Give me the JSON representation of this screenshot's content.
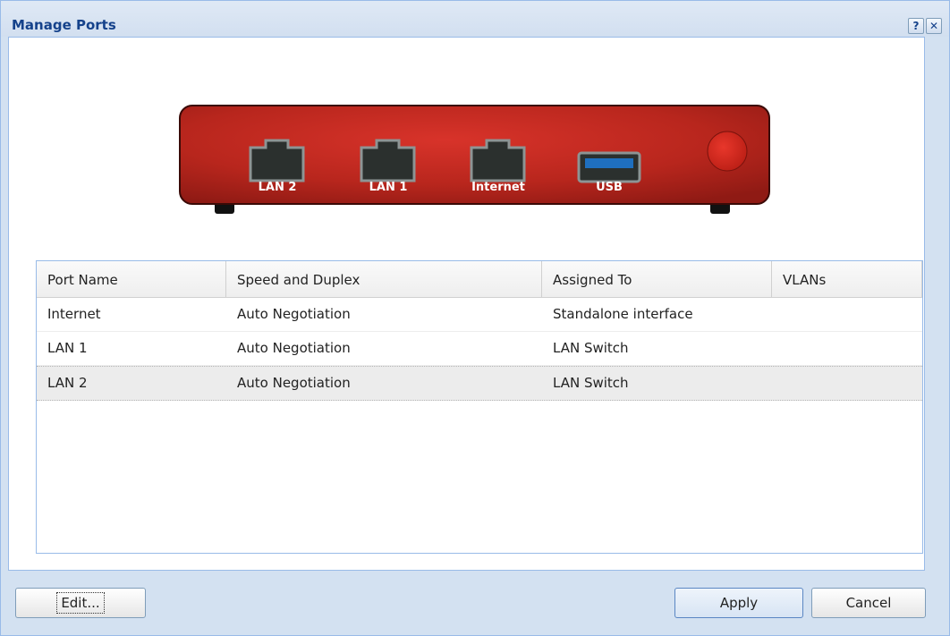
{
  "dialog": {
    "title": "Manage Ports",
    "help_glyph": "?",
    "close_glyph": "✕"
  },
  "device": {
    "ports": [
      {
        "label": "LAN 2",
        "kind": "ethernet"
      },
      {
        "label": "LAN 1",
        "kind": "ethernet"
      },
      {
        "label": "Internet",
        "kind": "ethernet"
      },
      {
        "label": "USB",
        "kind": "usb"
      }
    ],
    "body_color": "#c62a1f",
    "power_button_color": "#d4261c"
  },
  "grid": {
    "columns": [
      "Port Name",
      "Speed and Duplex",
      "Assigned To",
      "VLANs"
    ],
    "rows": [
      [
        "Internet",
        "Auto Negotiation",
        "Standalone interface",
        ""
      ],
      [
        "LAN 1",
        "Auto Negotiation",
        "LAN Switch",
        ""
      ],
      [
        "LAN 2",
        "Auto Negotiation",
        "LAN Switch",
        ""
      ]
    ],
    "selected_row": "LAN 2"
  },
  "buttons": {
    "edit": "Edit...",
    "apply": "Apply",
    "cancel": "Cancel"
  },
  "colors": {
    "title": "#15428b",
    "frame": "#d3e1f1",
    "border": "#99bbe8"
  }
}
